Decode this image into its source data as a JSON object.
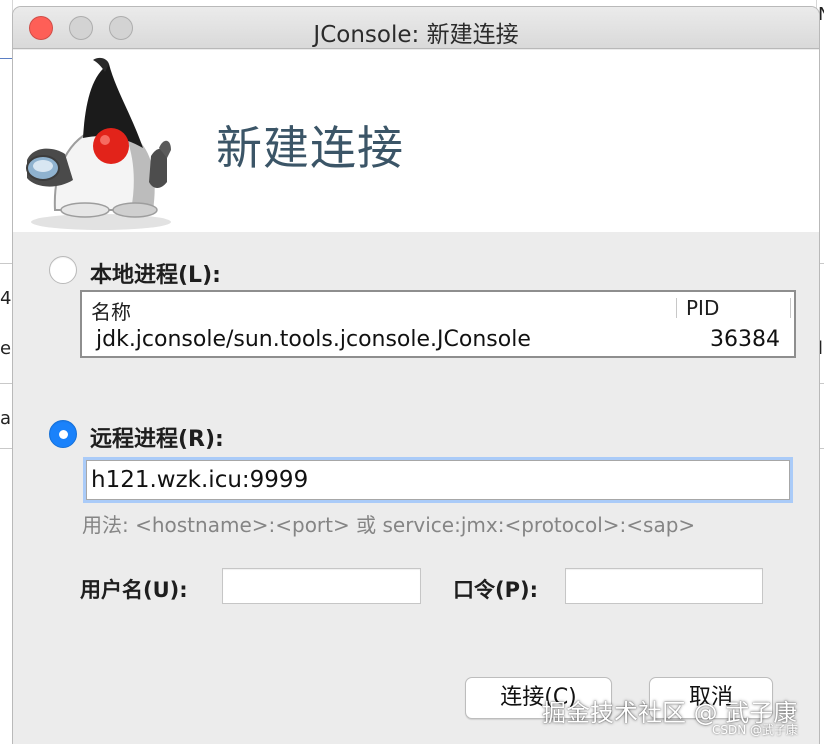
{
  "window": {
    "title": "JConsole: 新建连接"
  },
  "header": {
    "title": "新建连接",
    "mascot_icon": "java-duke-mascot-icon"
  },
  "local_process": {
    "radio_label": "本地进程(L):",
    "selected": false,
    "table": {
      "columns": [
        "名称",
        "PID"
      ],
      "rows": [
        {
          "name": "jdk.jconsole/sun.tools.jconsole.JConsole",
          "pid": "36384"
        }
      ]
    }
  },
  "remote_process": {
    "radio_label": "远程进程(R):",
    "selected": true,
    "value": "h121.wzk.icu:9999",
    "usage_hint": "用法: <hostname>:<port> 或 service:jmx:<protocol>:<sap>"
  },
  "credentials": {
    "username_label": "用户名(U):",
    "username_value": "",
    "password_label": "口令(P):",
    "password_value": ""
  },
  "buttons": {
    "connect_label": "连接(C)",
    "cancel_label": "取消"
  },
  "watermark": {
    "main": "掘金技术社区 @ 武子康",
    "sub": "CSDN @武子康"
  },
  "background_fragments": [
    "4",
    "e",
    "a",
    "l",
    "N"
  ],
  "colors": {
    "close_button": "#fe5f57",
    "radio_selected": "#1a82fb",
    "focus_ring": "#aacbf8",
    "header_title": "#3b5567"
  }
}
